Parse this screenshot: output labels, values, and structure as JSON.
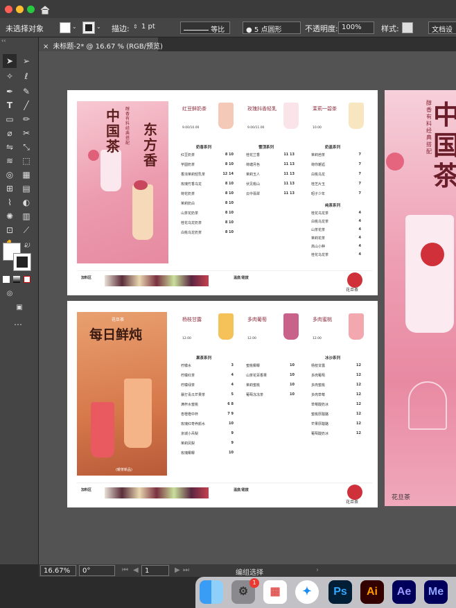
{
  "titlebar": {
    "colors": [
      "#ff5f57",
      "#febc2e",
      "#28c840"
    ],
    "home_icon": "home-icon"
  },
  "options": {
    "selection": "未选择对象",
    "stroke_label": "描边:",
    "stroke_value": "1 pt",
    "stroke_style": "等比",
    "brush": "5 点圆形",
    "opacity_label": "不透明度:",
    "opacity_value": "100%",
    "style_label": "样式:",
    "doc_setup": "文档设"
  },
  "document_tab": "未标题-2* @ 16.67 % (RGB/预览)",
  "status": {
    "zoom": "16.67%",
    "angle": "0°",
    "page": "1",
    "mode": "编组选择"
  },
  "dock": {
    "badge": "1",
    "apps": [
      "Ps",
      "Ai",
      "Ae",
      "Me"
    ]
  },
  "menu1": {
    "poster_title": "中国茶",
    "poster_title2": "东方香",
    "poster_sub": "醇香有料 经典搭配",
    "top_items": [
      {
        "name": "红豆鲜奶茶",
        "price": "9.00/10.00"
      },
      {
        "name": "玫瑰抖香轻乳",
        "price": "9.00/11.00"
      },
      {
        "name": "茉莉一碧茶",
        "price": "10.00"
      }
    ],
    "col1_title": "奶香系列",
    "col1": [
      {
        "n": "红豆奶茶",
        "p": "8  10"
      },
      {
        "n": "芋圆奶茶",
        "p": "8  10"
      },
      {
        "n": "香浓茉莉轻乳茶",
        "p": "12  14"
      },
      {
        "n": "玫瑰竹香乌龙",
        "p": "8  10"
      },
      {
        "n": "荷花奶茶",
        "p": "8  10"
      },
      {
        "n": "茉莉奶白",
        "p": "8  10"
      },
      {
        "n": "山茶花奶茶",
        "p": "8  10"
      },
      {
        "n": "桂花乌龙奶茶",
        "p": "8  10"
      },
      {
        "n": "白桃乌龙奶茶",
        "p": "8  10"
      }
    ],
    "col2_title": "雪顶系列",
    "col2": [
      {
        "n": "桂花兰香",
        "p": "11  13"
      },
      {
        "n": "荷塘月色",
        "p": "11  13"
      },
      {
        "n": "茉莉玉人",
        "p": "11  13"
      },
      {
        "n": "伏见桃山",
        "p": "11  13"
      },
      {
        "n": "云中翡翠",
        "p": "11  13"
      }
    ],
    "col3_title": "奶盖系列",
    "col3": [
      {
        "n": "茉莉芭茶",
        "p": "7"
      },
      {
        "n": "荷你邂逅",
        "p": "7"
      },
      {
        "n": "白桃乌龙",
        "p": "7"
      },
      {
        "n": "桂芝片玉",
        "p": "7"
      },
      {
        "n": "昭子少年",
        "p": "7"
      }
    ],
    "col4_title": "纯茶系列",
    "col4": [
      {
        "n": "桂花乌龙茶",
        "p": "4"
      },
      {
        "n": "白桃乌龙茶",
        "p": "4"
      },
      {
        "n": "山茶花茶",
        "p": "4"
      },
      {
        "n": "茉莉花茶",
        "p": "4"
      },
      {
        "n": "高山小种",
        "p": "4"
      },
      {
        "n": "桂花乌龙茶",
        "p": "4"
      }
    ],
    "footer_left": "加料区",
    "footer_mid": "温度/甜度",
    "brand": "花旦茶"
  },
  "menu2": {
    "poster_title": "每日鲜炖",
    "poster_badge": "花旦茶",
    "poster_bottom": "(暖茶新品)",
    "top_items": [
      {
        "name": "杨枝甘露",
        "price": "12.00"
      },
      {
        "name": "多肉葡萄",
        "price": "12.00"
      },
      {
        "name": "多肉蜜桃",
        "price": "12.00"
      }
    ],
    "col1_title": "果茶系列",
    "col1": [
      {
        "n": "柠檬水",
        "p": "3"
      },
      {
        "n": "柠檬红茶",
        "p": "4"
      },
      {
        "n": "柠檬绿茶",
        "p": "4"
      },
      {
        "n": "暴打青瓜芒果茶",
        "p": "5"
      },
      {
        "n": "满杯水蜜桃",
        "p": "6  8"
      },
      {
        "n": "杏橙橙中杯",
        "p": "7  9"
      },
      {
        "n": "玫瑰红枣养颜水",
        "p": "10"
      },
      {
        "n": "京城小吊梨",
        "p": "9"
      },
      {
        "n": "茉莉凤梨",
        "p": "9"
      },
      {
        "n": "玫瑰椰椰",
        "p": "10"
      }
    ],
    "col2": [
      {
        "n": "蜜桃椰椰",
        "p": "10"
      },
      {
        "n": "山茶花百香果",
        "p": "10"
      },
      {
        "n": "茉莉蜜桃",
        "p": "10"
      },
      {
        "n": "葡萄冻冻茶",
        "p": "10"
      }
    ],
    "col3_title": "冰沙系列",
    "col3": [
      {
        "n": "杨枝甘露",
        "p": "12"
      },
      {
        "n": "多肉葡萄",
        "p": "12"
      },
      {
        "n": "多肉蜜桃",
        "p": "12"
      },
      {
        "n": "多肉草莓",
        "p": "12"
      },
      {
        "n": "草莓酸奶冰",
        "p": "12"
      },
      {
        "n": "蜜桃厚酸酪",
        "p": "12"
      },
      {
        "n": "芒果厚酸酪",
        "p": "12"
      },
      {
        "n": "葡萄酸奶冰",
        "p": "12"
      }
    ],
    "footer_left": "加料区",
    "footer_mid": "温度/甜度",
    "brand": "花旦茶"
  },
  "right_poster": {
    "title": "中国茶",
    "sub": "醇香有料 经典搭配",
    "brand": "花旦茶"
  }
}
